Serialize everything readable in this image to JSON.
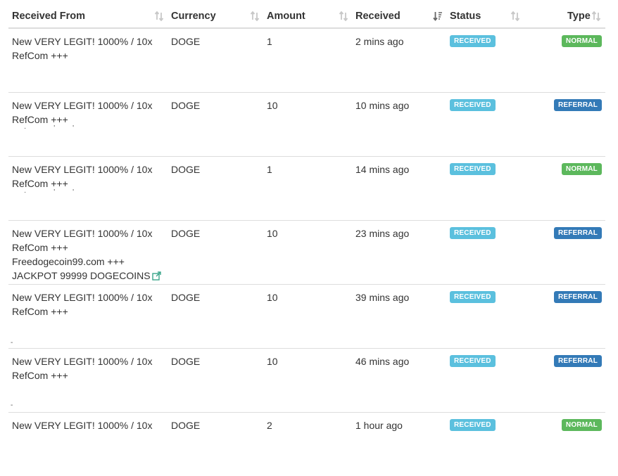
{
  "table": {
    "columns": [
      {
        "label": "Received From",
        "sort": "none"
      },
      {
        "label": "Currency",
        "sort": "none"
      },
      {
        "label": "Amount",
        "sort": "none"
      },
      {
        "label": "Received",
        "sort": "descending"
      },
      {
        "label": "Status",
        "sort": "none"
      },
      {
        "label": "Type",
        "sort": "none"
      }
    ],
    "rows": [
      {
        "from": [
          "New VERY LEGIT! 1000% / 10x",
          "RefCom +++"
        ],
        "currency": "DOGE",
        "amount": "1",
        "received": "2 mins ago",
        "status": "RECEIVED",
        "type": "NORMAL"
      },
      {
        "from": [
          "New VERY LEGIT! 1000% / 10x",
          "RefCom +++"
        ],
        "currency": "DOGE",
        "amount": "10",
        "received": "10 mins ago",
        "status": "RECEIVED",
        "type": "REFERRAL"
      },
      {
        "from": [
          "New VERY LEGIT! 1000% / 10x",
          "RefCom +++"
        ],
        "currency": "DOGE",
        "amount": "1",
        "received": "14 mins ago",
        "status": "RECEIVED",
        "type": "NORMAL"
      },
      {
        "from": [
          "New VERY LEGIT! 1000% / 10x",
          "RefCom +++",
          "Freedogecoin99.com +++",
          "JACKPOT 99999 DOGECOINS"
        ],
        "currency": "DOGE",
        "amount": "10",
        "received": "23 mins ago",
        "status": "RECEIVED",
        "type": "REFERRAL",
        "external_link": true
      },
      {
        "from": [
          "New VERY LEGIT! 1000% / 10x",
          "RefCom +++"
        ],
        "currency": "DOGE",
        "amount": "10",
        "received": "39 mins ago",
        "status": "RECEIVED",
        "type": "REFERRAL"
      },
      {
        "from": [
          "New VERY LEGIT! 1000% / 10x",
          "RefCom +++"
        ],
        "currency": "DOGE",
        "amount": "10",
        "received": "46 mins ago",
        "status": "RECEIVED",
        "type": "REFERRAL"
      },
      {
        "from": [
          "New VERY LEGIT! 1000% / 10x"
        ],
        "currency": "DOGE",
        "amount": "2",
        "received": "1 hour ago",
        "status": "RECEIVED",
        "type": "NORMAL"
      }
    ]
  },
  "colors": {
    "status_received": "#5bc0de",
    "type_normal": "#5cb85c",
    "type_referral": "#337ab7",
    "external_link": "#3aa58a"
  },
  "icons": {
    "sort": "sort-both-icon",
    "sort_active": "sort-descending-icon",
    "external_link": "external-link-icon"
  }
}
